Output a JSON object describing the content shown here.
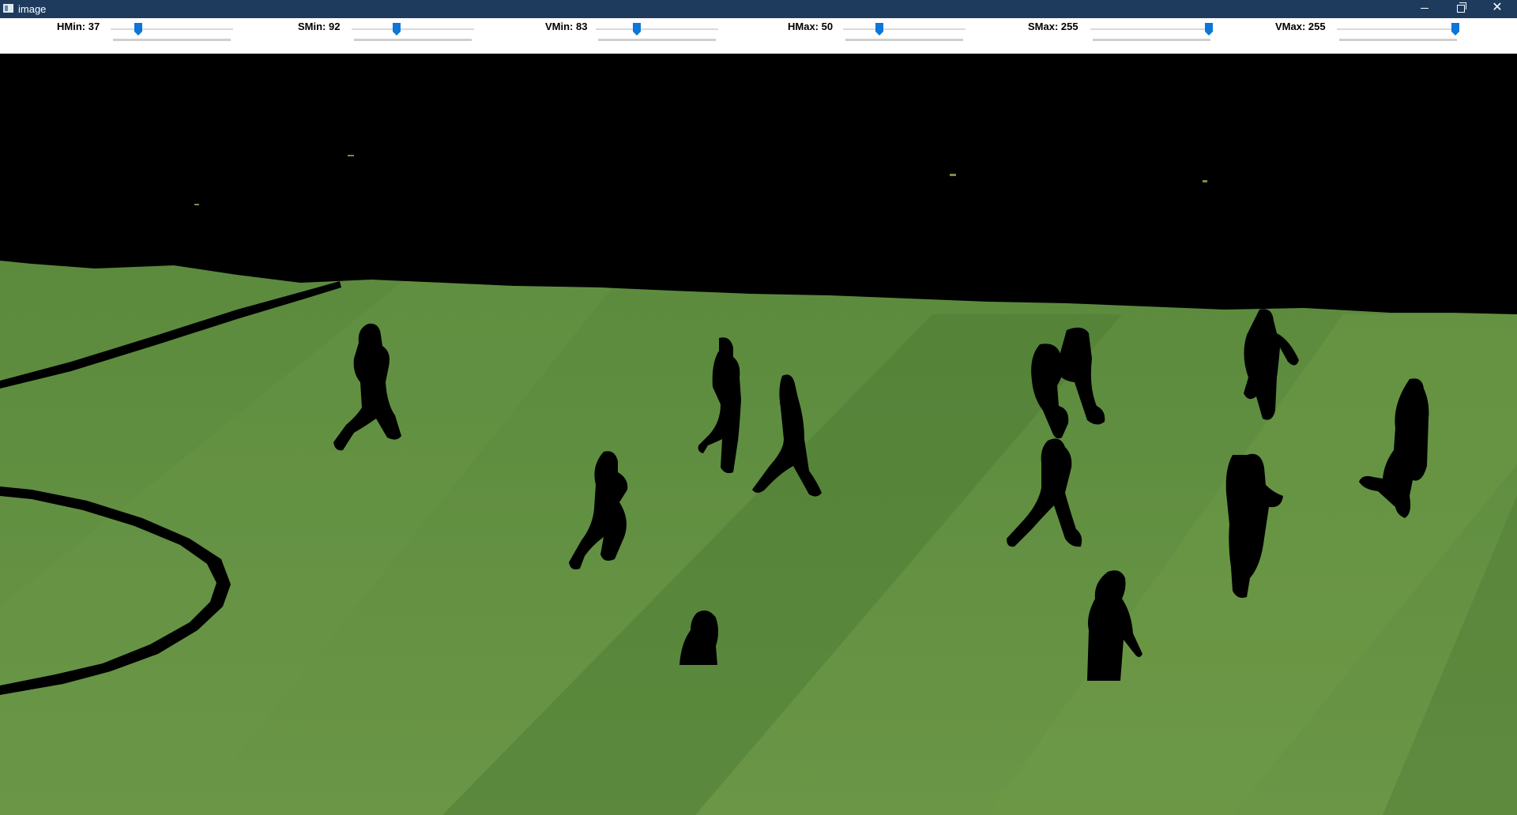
{
  "window": {
    "title": "image",
    "icon": "app-window-icon"
  },
  "title_buttons": {
    "minimize": "minimize-icon",
    "restore": "restore-icon",
    "close": "close-icon",
    "close_glyph": "✕"
  },
  "trackbars": [
    {
      "name": "HMin",
      "label": "HMin: 37",
      "value": 37,
      "max": 179
    },
    {
      "name": "SMin",
      "label": "SMin: 92",
      "value": 92,
      "max": 255
    },
    {
      "name": "VMin",
      "label": "VMin: 83",
      "value": 83,
      "max": 255
    },
    {
      "name": "HMax",
      "label": "HMax: 50",
      "value": 50,
      "max": 179
    },
    {
      "name": "SMax",
      "label": "SMax: 255",
      "value": 255,
      "max": 255
    },
    {
      "name": "VMax",
      "label": "VMax: 255",
      "value": 255,
      "max": 255
    }
  ],
  "colors": {
    "title_bar": "#1e3b5e",
    "thumb": "#0d77d9",
    "grass_light": "#5f8f3f",
    "grass_dark": "#4a7a32",
    "mask": "#000000"
  },
  "image": {
    "content": "hsv-masked-football-pitch",
    "masked_objects": "player-silhouettes"
  }
}
